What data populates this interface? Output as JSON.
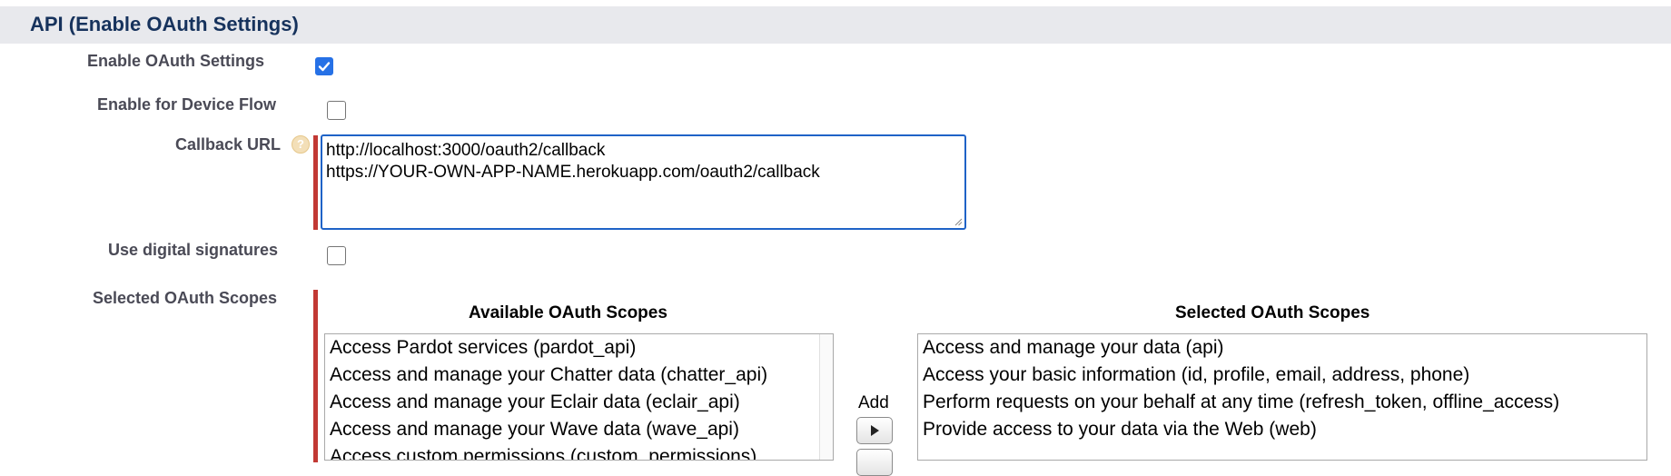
{
  "section": {
    "title": "API (Enable OAuth Settings)"
  },
  "fields": {
    "enable_oauth": {
      "label": "Enable OAuth Settings",
      "checked": true
    },
    "device_flow": {
      "label": "Enable for Device Flow",
      "checked": false
    },
    "callback_url": {
      "label": "Callback URL",
      "lines": [
        "http://localhost:3000/oauth2/callback",
        "https://YOUR-OWN-APP-NAME.herokuapp.com/oauth2/callback"
      ]
    },
    "digital_signatures": {
      "label": "Use digital signatures",
      "checked": false
    },
    "oauth_scopes": {
      "label": "Selected OAuth Scopes"
    }
  },
  "scopes": {
    "available_title": "Available OAuth Scopes",
    "selected_title": "Selected OAuth Scopes",
    "available": [
      "Access Pardot services (pardot_api)",
      "Access and manage your Chatter data (chatter_api)",
      "Access and manage your Eclair data (eclair_api)",
      "Access and manage your Wave data (wave_api)",
      "Access custom permissions (custom_permissions)"
    ],
    "selected": [
      "Access and manage your data (api)",
      "Access your basic information (id, profile, email, address, phone)",
      "Perform requests on your behalf at any time (refresh_token, offline_access)",
      "Provide access to your data via the Web (web)"
    ],
    "add_label": "Add"
  },
  "colors": {
    "required": "#c23934",
    "checkbox": "#2671e6",
    "focus_border": "#1f63c7",
    "header_bg": "#e8e9ed"
  }
}
